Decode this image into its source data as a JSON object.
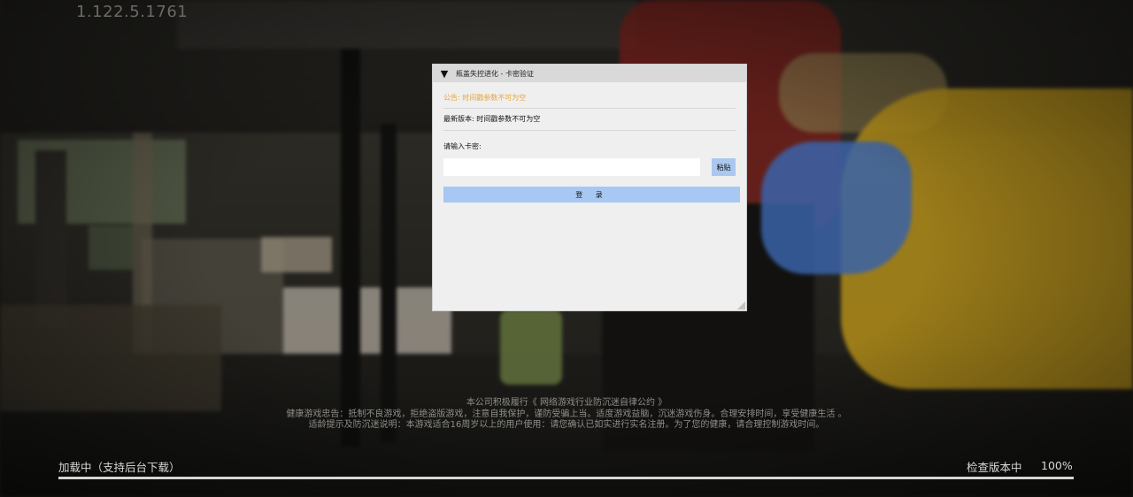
{
  "version": "1.122.5.1761",
  "dialog": {
    "collapse_glyph": "▼",
    "title": "瓶盖失控进化 - 卡密验证",
    "notice": "公告: 时间戳参数不可为空",
    "latest_version": "最新版本: 时间戳参数不可为空",
    "card_label": "请输入卡密:",
    "card_value": "",
    "paste_label": "粘贴",
    "login_label": "登 录",
    "notice_color": "#e6a23c",
    "button_color": "#a6c8f2"
  },
  "footer": {
    "line1": "本公司积极履行《 网络游戏行业防沉迷自律公约 》",
    "line2": "健康游戏忠告：抵制不良游戏，拒绝盗版游戏，注意自我保护，谨防受骗上当。适度游戏益脑，沉迷游戏伤身。合理安排时间，享受健康生活 。",
    "line3": "适龄提示及防沉迷说明：本游戏适合16周岁以上的用户使用：请您确认已如实进行实名注册。为了您的健康，请合理控制游戏时间。"
  },
  "loading": {
    "label": "加载中（支持后台下载）",
    "status": "检查版本中",
    "percent_text": "100%",
    "progress": 1.0
  }
}
